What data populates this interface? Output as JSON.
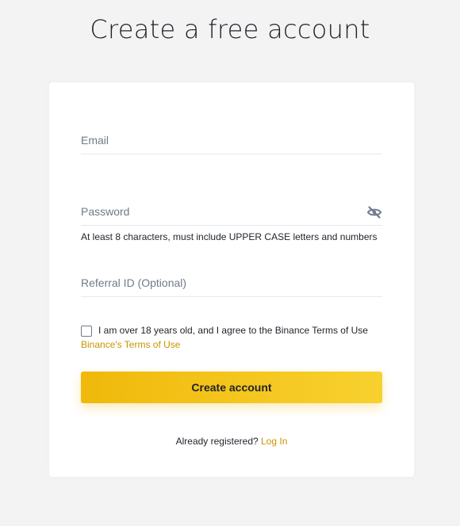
{
  "page": {
    "title": "Create a free account"
  },
  "form": {
    "email": {
      "placeholder": "Email",
      "value": ""
    },
    "password": {
      "placeholder": "Password",
      "value": "",
      "toggle_icon": "eye-slash-icon",
      "hint": "At least 8 characters, must include UPPER CASE letters and numbers"
    },
    "referral": {
      "placeholder": "Referral ID (Optional)",
      "value": ""
    },
    "terms": {
      "checked": false,
      "label": "I am over 18 years old, and I agree to the Binance Terms of Use",
      "link_label": "Binance's Terms of Use"
    },
    "submit_label": "Create account"
  },
  "footer": {
    "prompt": "Already registered?",
    "login_label": "Log In"
  },
  "colors": {
    "background": "#f3f3f3",
    "card": "#ffffff",
    "brand_yellow": "#f0b90b",
    "brand_yellow_light": "#f8d12f",
    "link_gold": "#c99400",
    "text_primary": "#1e2329",
    "text_placeholder": "#707a8a"
  }
}
